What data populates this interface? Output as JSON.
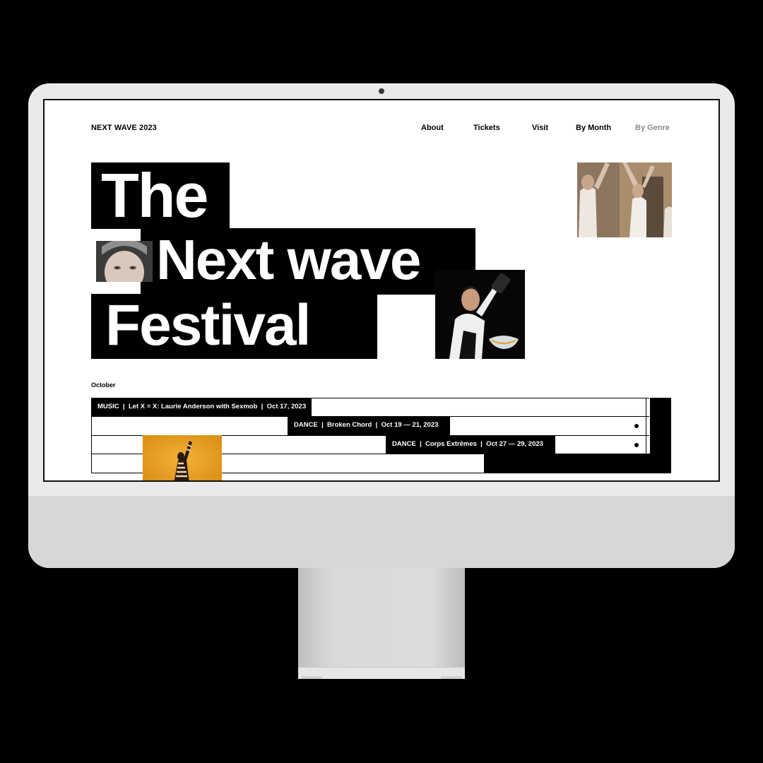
{
  "site": {
    "brand": "NEXT WAVE 2023",
    "nav": [
      {
        "label": "About",
        "active": true
      },
      {
        "label": "Tickets",
        "active": true
      },
      {
        "label": "Visit",
        "active": true
      },
      {
        "label": "By Month",
        "active": true
      },
      {
        "label": "By Genre",
        "active": false
      }
    ]
  },
  "hero": {
    "line1": "The",
    "line2": "Next wave",
    "line3": "Festival"
  },
  "events": {
    "month": "October",
    "items": [
      {
        "genre": "MUSIC",
        "title": "Let X = X: Laurie Anderson with Sexmob",
        "date": "Oct 17, 2023",
        "sep": "|"
      },
      {
        "genre": "DANCE",
        "title": "Broken Chord",
        "date": "Oct 19 — 21, 2023",
        "sep": "|"
      },
      {
        "genre": "DANCE",
        "title": "Corps Extrêmes",
        "date": "Oct 27 — 29, 2023",
        "sep": "|"
      }
    ]
  },
  "colors": {
    "background": "#000000",
    "screen": "#ffffff",
    "ink": "#000000",
    "muted_nav": "#8a8a8a",
    "photo_accent": "#e8a21c"
  },
  "icons": [
    "camera-icon",
    "row-dot-icon"
  ]
}
